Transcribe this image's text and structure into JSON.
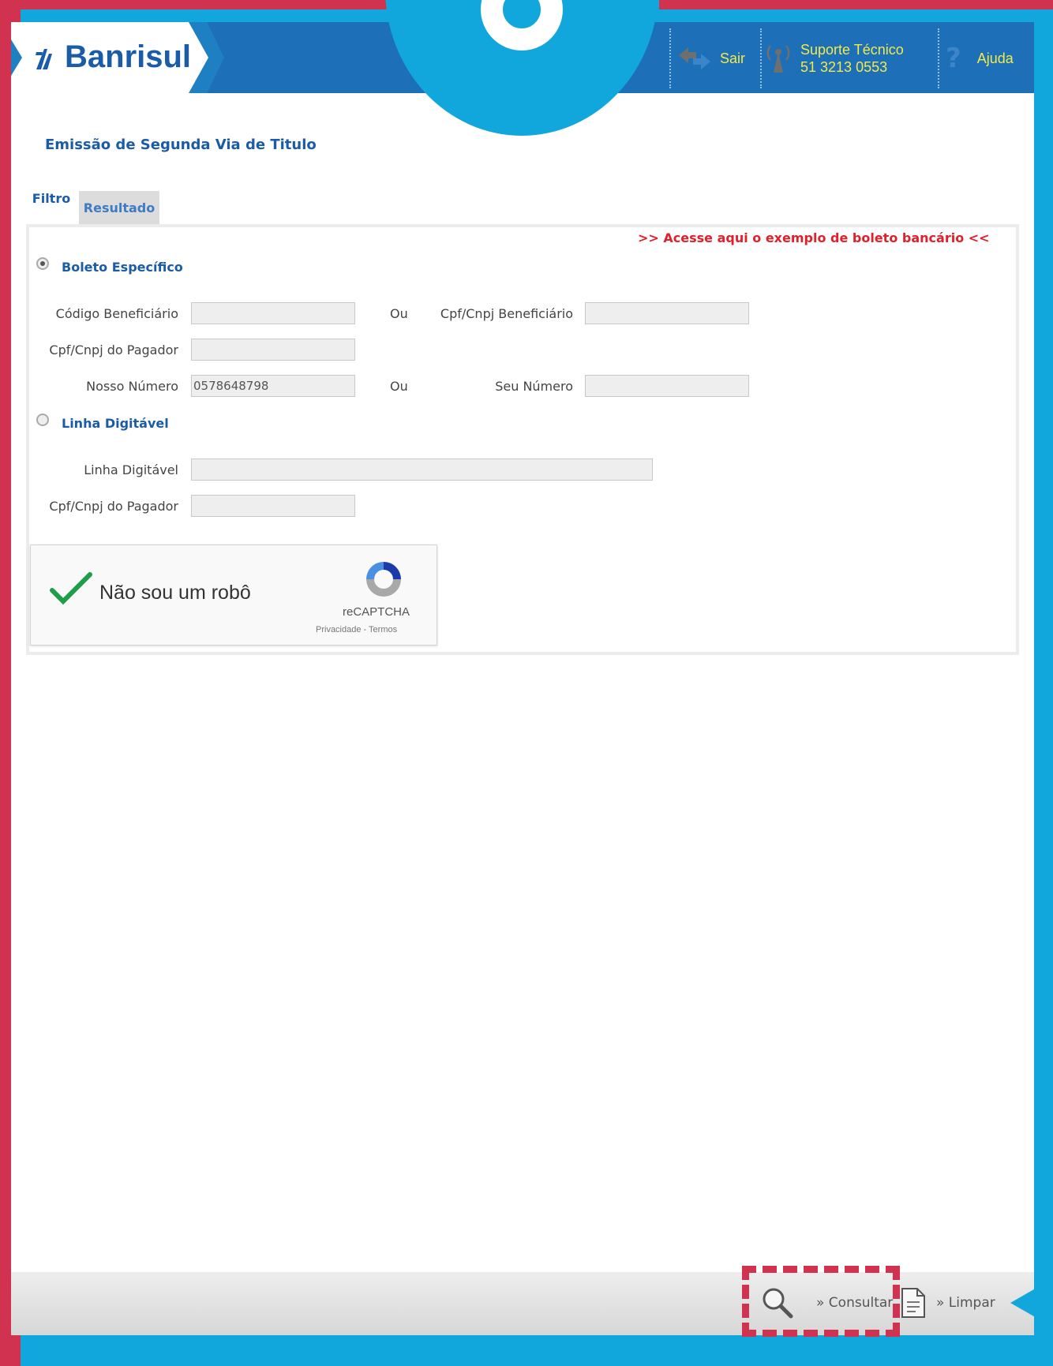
{
  "header": {
    "logo_text": "Banrisul",
    "sair_label": "Sair",
    "suporte_label": "Suporte Técnico",
    "suporte_phone": "51 3213 0553",
    "ajuda_label": "Ajuda"
  },
  "page": {
    "title": "Emissão de Segunda Via de Titulo"
  },
  "tabs": {
    "filtro": "Filtro",
    "resultado": "Resultado"
  },
  "form": {
    "exemplo_link": ">> Acesse aqui o exemplo de boleto bancário <<",
    "option_especifico": "Boleto Específico",
    "option_linha": "Linha Digitável",
    "ou": "Ou",
    "codigo_beneficiario_label": "Código Beneficiário",
    "cpf_cnpj_beneficiario_label": "Cpf/Cnpj Beneficiário",
    "cpf_cnpj_pagador_label": "Cpf/Cnpj do Pagador",
    "nosso_numero_label": "Nosso Número",
    "nosso_numero_value": "0578648798",
    "seu_numero_label": "Seu Número",
    "linha_digitavel_label": "Linha Digitável",
    "cpf_cnpj_pagador2_label": "Cpf/Cnpj do Pagador",
    "selected_option": "Boleto Específico"
  },
  "captcha": {
    "label": "Não sou um robô",
    "brand": "reCAPTCHA",
    "terms": "Privacidade - Termos",
    "checked": true
  },
  "footer": {
    "consultar": "» Consultar",
    "limpar": "» Limpar"
  },
  "colors": {
    "brand_blue": "#1a5ca8",
    "frame_cyan": "#12a7dc",
    "frame_red": "#d0324f",
    "link_red": "#e0202a",
    "header_yellow": "#f3e94a"
  }
}
